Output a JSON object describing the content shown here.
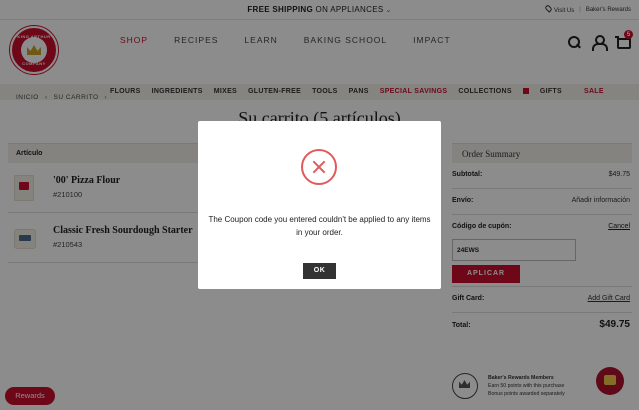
{
  "banner": {
    "promo_bold": "FREE SHIPPING",
    "promo_rest": " ON APPLIANCES",
    "visit_us": "Visit Us",
    "bakers_rewards": "Baker's Rewards"
  },
  "logo": {
    "top_text": "KING ARTHUR",
    "bottom_text": "BAKING COMPANY"
  },
  "main_nav": [
    "SHOP",
    "RECIPES",
    "LEARN",
    "BAKING SCHOOL",
    "IMPACT"
  ],
  "cart_count": "5",
  "sub_nav": [
    "FLOURS",
    "INGREDIENTS",
    "MIXES",
    "GLUTEN-FREE",
    "TOOLS",
    "PANS",
    "SPECIAL SAVINGS",
    "COLLECTIONS",
    "GIFTS",
    "SALE"
  ],
  "breadcrumb": [
    "INICIO",
    "SU CARRITO"
  ],
  "page_title": "Su carrito (5 artículos)",
  "table": {
    "header": "Artículo"
  },
  "items": [
    {
      "name": "'00' Pizza Flour",
      "sku": "#210100"
    },
    {
      "name": "Classic Fresh Sourdough Starter",
      "sku": "#210543"
    }
  ],
  "summary": {
    "title": "Order Summary",
    "subtotal_label": "Subtotal:",
    "subtotal_value": "$49.75",
    "shipping_label": "Envío:",
    "shipping_value": "Añadir información",
    "coupon_label": "Código de cupón:",
    "coupon_cancel": "Cancel",
    "coupon_value": "24EWS",
    "apply_label": "APLICAR",
    "giftcard_label": "Gift Card:",
    "giftcard_link": "Add Gift Card",
    "total_label": "Total:",
    "total_value": "$49.75"
  },
  "rewards_promo": {
    "title": "Baker's Rewards Members",
    "line1": "Earn 50 points with this purchase",
    "line2": "Bonus points awarded separately"
  },
  "rewards_pill": "Rewards",
  "modal": {
    "message": "The Coupon code you entered couldn't be applied to any items in your order.",
    "ok_label": "OK"
  },
  "colors": {
    "brand_red": "#c8102e",
    "error_red": "#e15b5b"
  }
}
